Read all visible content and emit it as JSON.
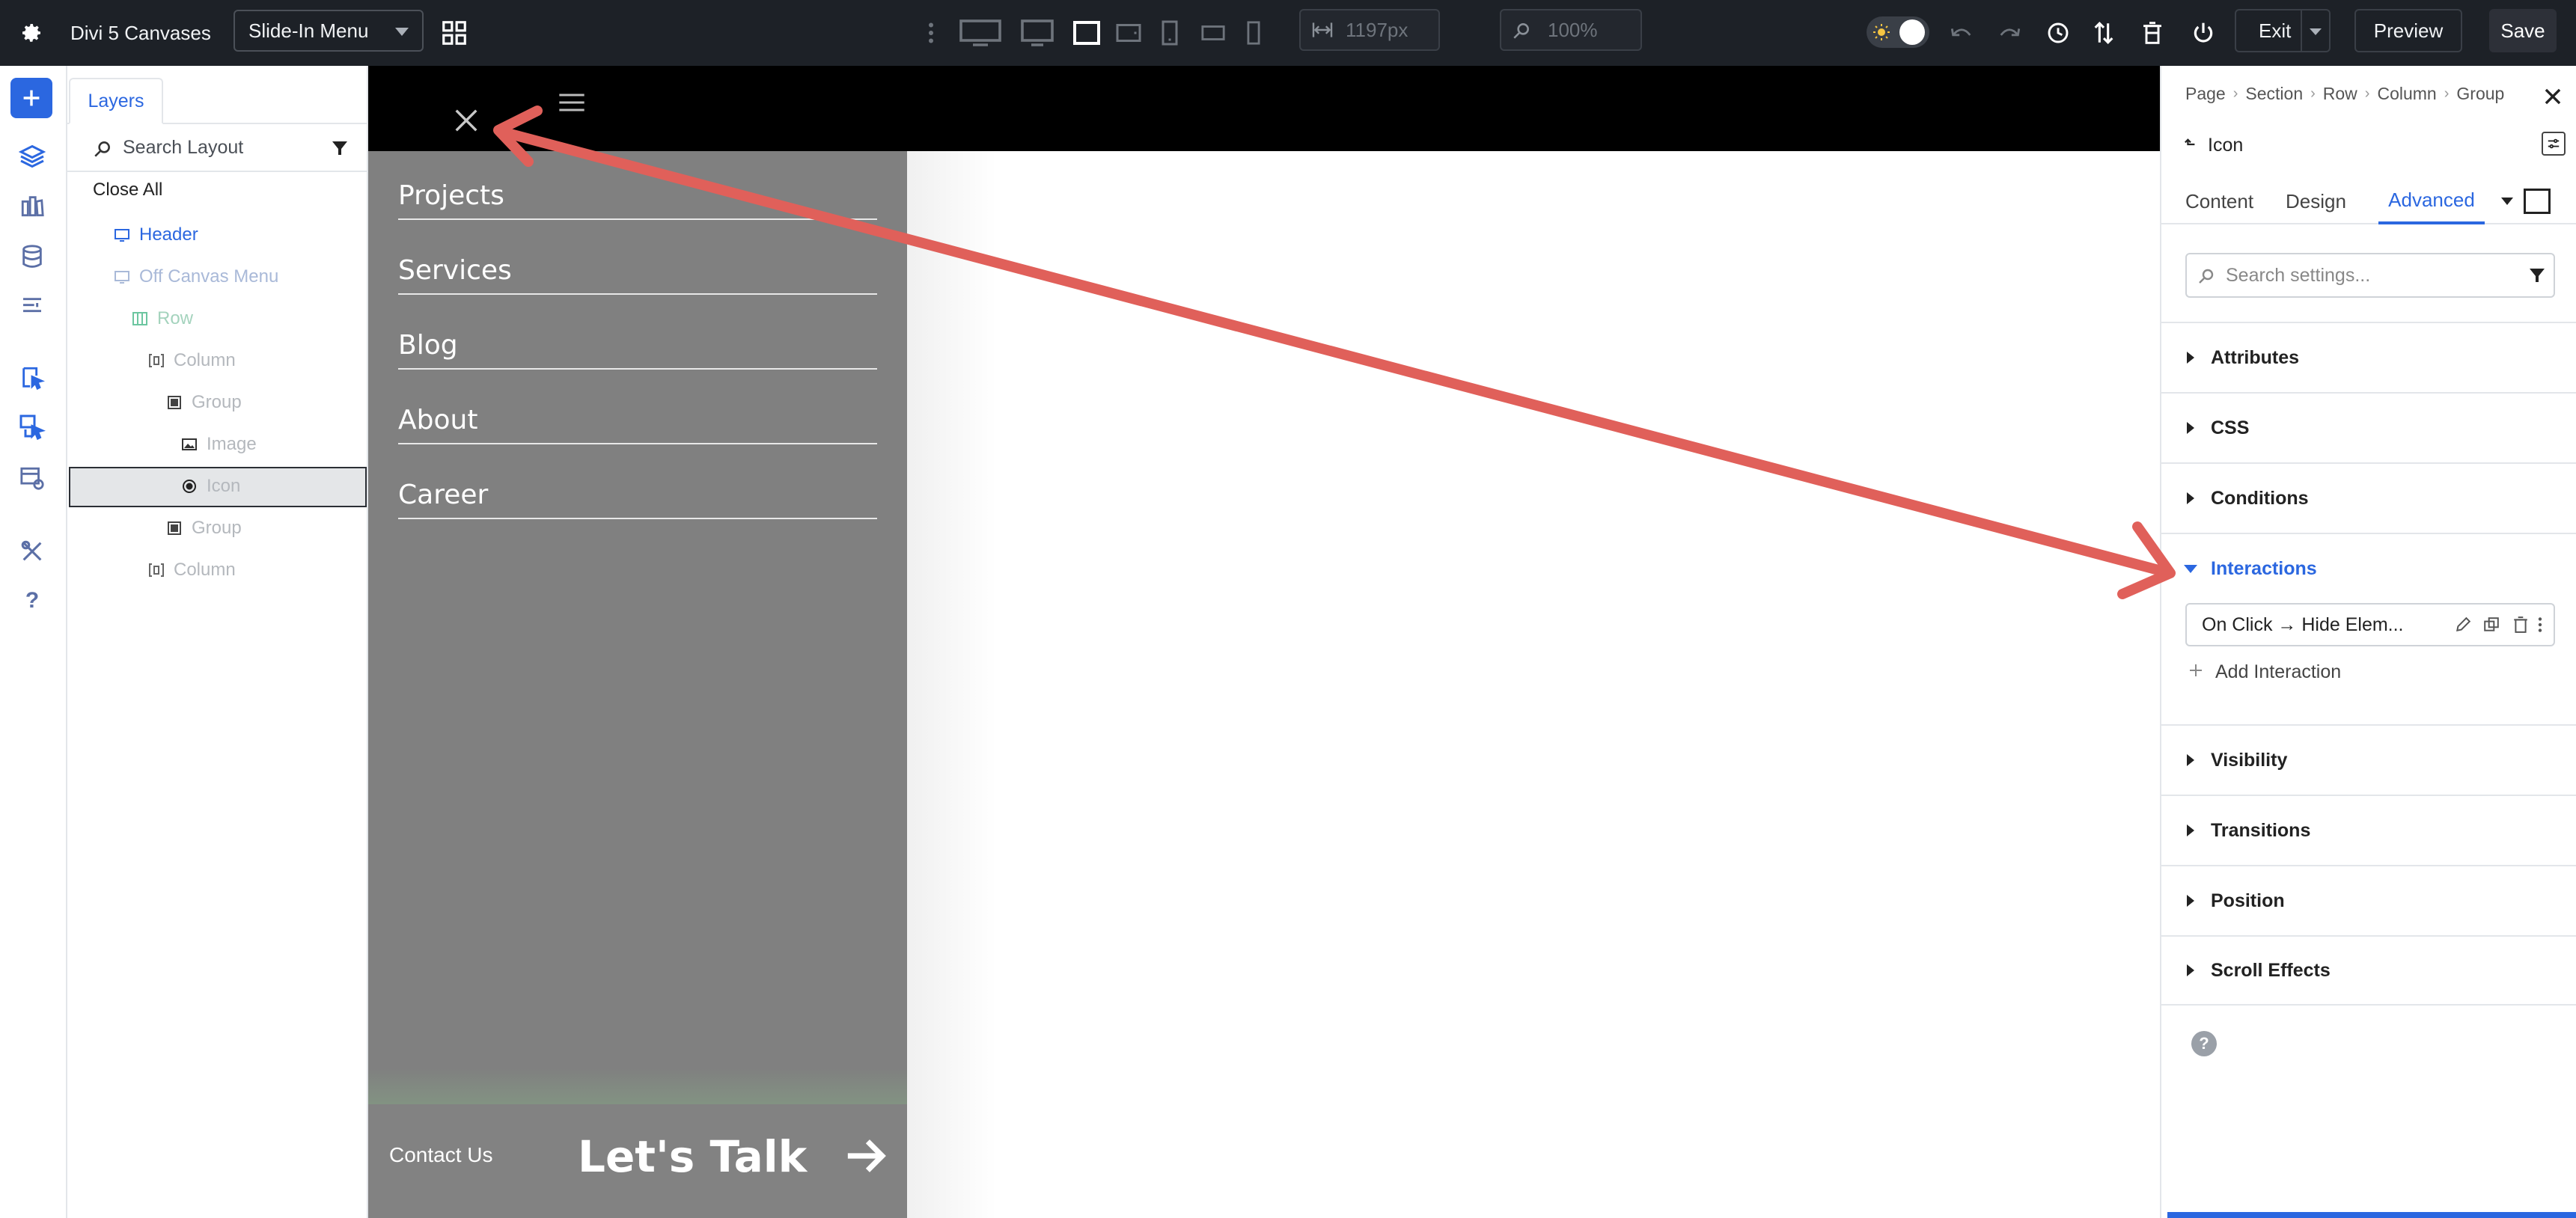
{
  "topbar": {
    "title": "Divi 5 Canvases",
    "canvas_select": "Slide-In Menu",
    "width_value": "1197px",
    "zoom_value": "100%",
    "exit_label": "Exit",
    "preview_label": "Preview",
    "save_label": "Save"
  },
  "layers": {
    "tab_label": "Layers",
    "search_placeholder": "Search Layout",
    "close_all": "Close All",
    "tree": [
      {
        "label": "Header"
      },
      {
        "label": "Off Canvas Menu"
      },
      {
        "label": "Row"
      },
      {
        "label": "Column"
      },
      {
        "label": "Group"
      },
      {
        "label": "Image"
      },
      {
        "label": "Icon"
      },
      {
        "label": "Group"
      },
      {
        "label": "Column"
      }
    ]
  },
  "canvas": {
    "menu_links": [
      "Projects",
      "Services",
      "Blog",
      "About",
      "Career"
    ],
    "footer_contact": "Contact Us",
    "footer_cta": "Let's Talk"
  },
  "settings": {
    "breadcrumb": [
      "Page",
      "Section",
      "Row",
      "Column",
      "Group"
    ],
    "module_title": "Icon",
    "tabs": [
      "Content",
      "Design",
      "Advanced"
    ],
    "search_placeholder": "Search settings...",
    "sections": [
      "Attributes",
      "CSS",
      "Conditions",
      "Interactions",
      "Visibility",
      "Transitions",
      "Position",
      "Scroll Effects"
    ],
    "interaction_item": "On Click → Hide Elem...",
    "add_interaction": "Add Interaction"
  },
  "colors": {
    "accent": "#2b67e0",
    "topbar": "#1d2127",
    "arrow": "#e0605a",
    "menu_panel": "#808080"
  }
}
